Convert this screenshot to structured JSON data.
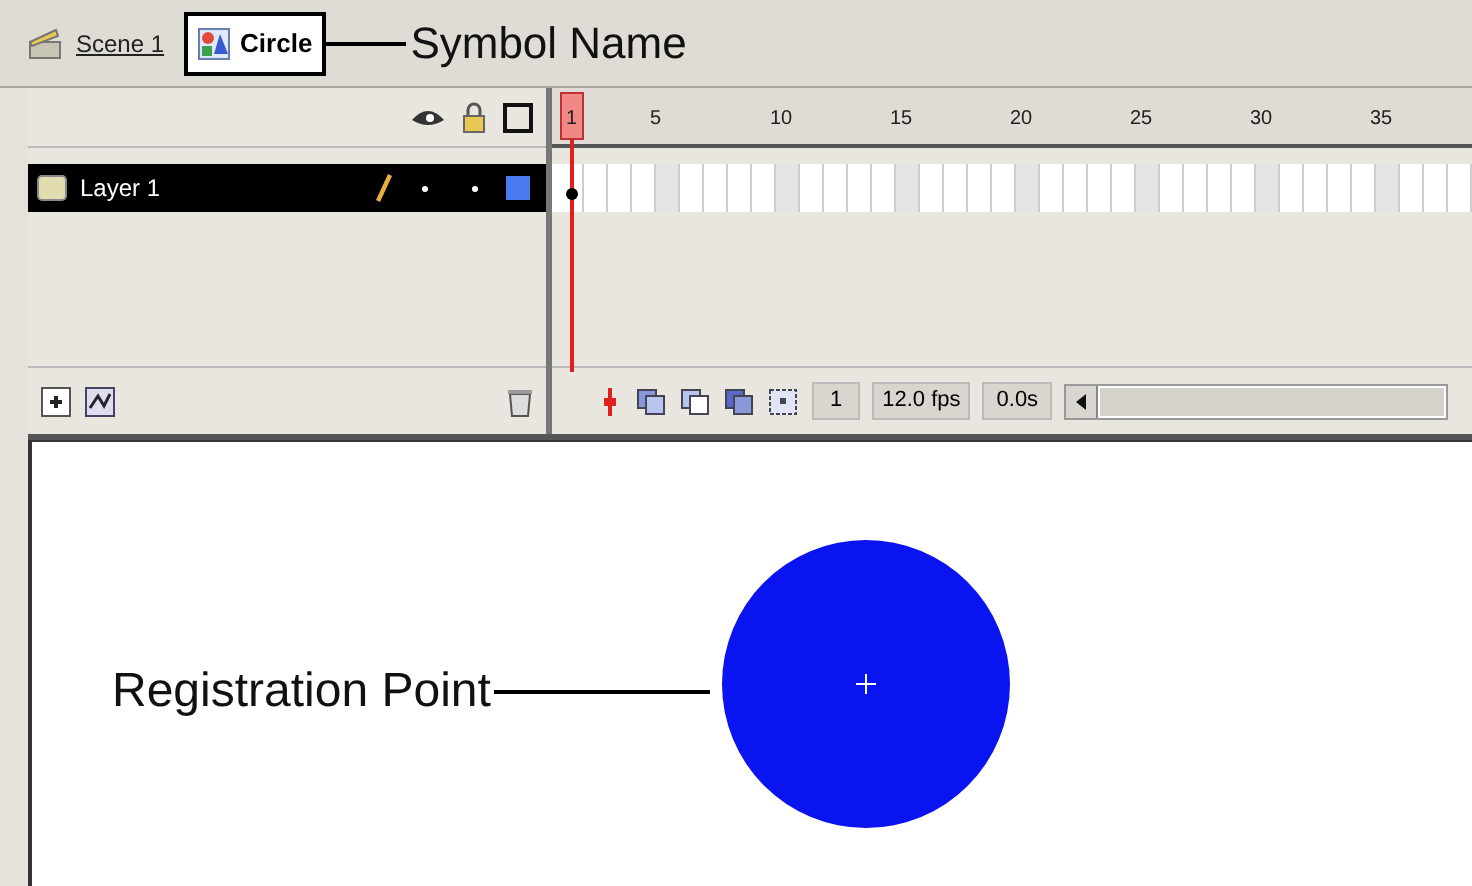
{
  "breadcrumb": [
    {
      "kind": "scene",
      "label": "Scene 1"
    },
    {
      "kind": "symbol",
      "label": "Circle"
    }
  ],
  "symbol_callout": "Symbol Name",
  "layers": [
    {
      "name": "Layer 1",
      "selected": true,
      "color": "#4a7cf0"
    }
  ],
  "ruler": [
    "1",
    "5",
    "10",
    "15",
    "20",
    "25",
    "30",
    "35"
  ],
  "status": {
    "frame": "1",
    "fps": "12.0 fps",
    "time": "0.0s"
  },
  "stage": {
    "callout": "Registration Point"
  }
}
